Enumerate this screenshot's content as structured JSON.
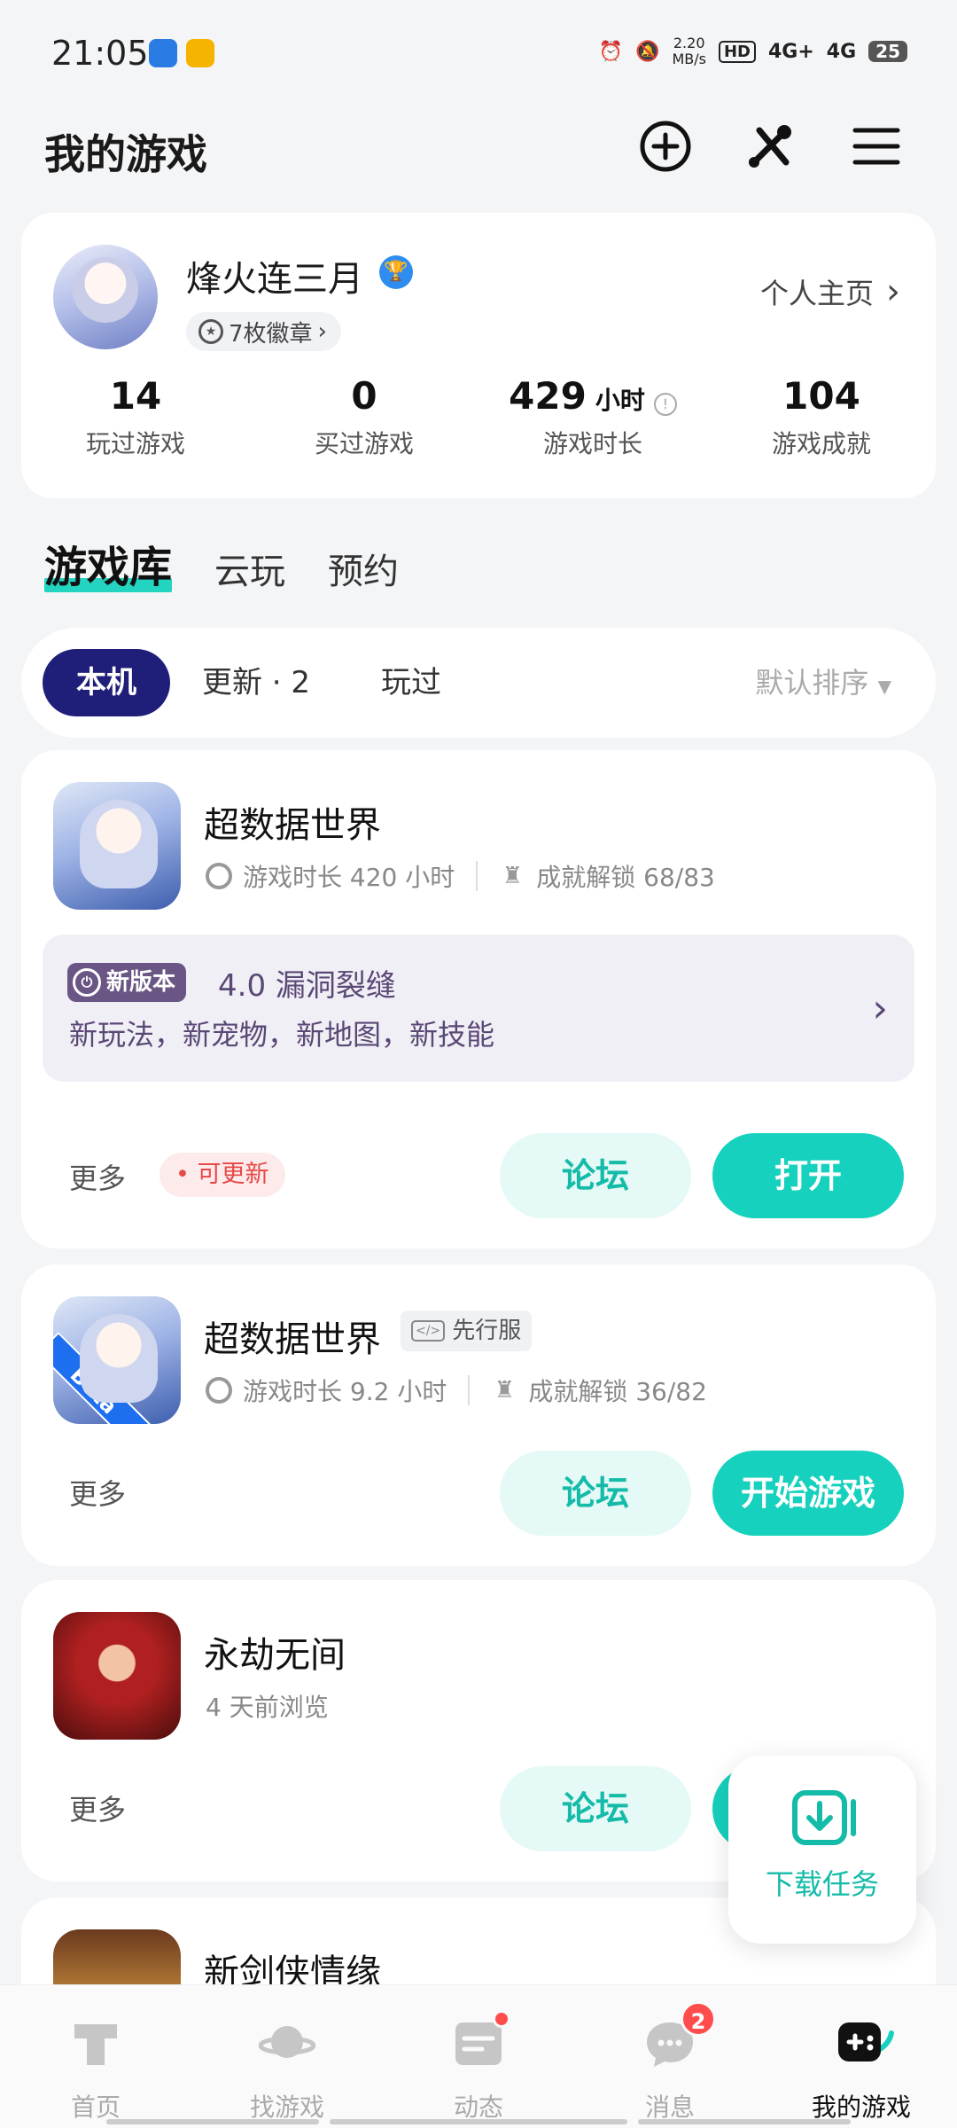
{
  "status_bar": {
    "time": "21:05",
    "net_speed_value": "2.20",
    "net_speed_unit": "MB/s",
    "hd_label": "HD",
    "sim1": "4G+",
    "sim2": "4G",
    "battery": "25"
  },
  "header": {
    "title": "我的游戏",
    "icons": [
      "add-icon",
      "tools-icon",
      "menu-icon"
    ]
  },
  "profile": {
    "username": "烽火连三月",
    "medals": "7枚徽章",
    "home_link": "个人主页",
    "stats": [
      {
        "value": "14",
        "unit": "",
        "label": "玩过游戏"
      },
      {
        "value": "0",
        "unit": "",
        "label": "买过游戏"
      },
      {
        "value": "429",
        "unit": "小时",
        "label": "游戏时长"
      },
      {
        "value": "104",
        "unit": "",
        "label": "游戏成就"
      }
    ]
  },
  "section_tabs": [
    "游戏库",
    "云玩",
    "预约"
  ],
  "filters": {
    "chips": [
      "本机",
      "更新 · 2",
      "玩过"
    ],
    "sort": "默认排序"
  },
  "games": [
    {
      "name": "超数据世界",
      "playtime": "游戏时长 420 小时",
      "achievements": "成就解锁 68/83",
      "update": {
        "badge": "新版本",
        "title": "4.0 漏洞裂缝",
        "desc": "新玩法，新宠物，新地图，新技能"
      },
      "more": "更多",
      "update_tag": "可更新",
      "forum": "论坛",
      "action": "打开"
    },
    {
      "name": "超数据世界",
      "tag": "先行服",
      "ribbon": "Beta",
      "playtime": "游戏时长 9.2 小时",
      "achievements": "成就解锁 36/82",
      "more": "更多",
      "forum": "论坛",
      "action": "开始游戏"
    },
    {
      "name": "永劫无间",
      "browsed": "4 天前浏览",
      "more": "更多",
      "forum": "论坛"
    },
    {
      "name": "新剑侠情缘"
    }
  ],
  "float_download": {
    "label": "下载任务"
  },
  "bottom_nav": [
    {
      "label": "首页",
      "icon": "home-icon"
    },
    {
      "label": "找游戏",
      "icon": "planet-icon"
    },
    {
      "label": "动态",
      "icon": "feed-icon"
    },
    {
      "label": "消息",
      "icon": "chat-icon",
      "badge": "2"
    },
    {
      "label": "我的游戏",
      "icon": "gamepad-icon"
    }
  ],
  "colors": {
    "accent": "#16d1bd",
    "active_chip": "#1f1f7a",
    "update_panel": "#f1eff6",
    "alert": "#e64848"
  }
}
